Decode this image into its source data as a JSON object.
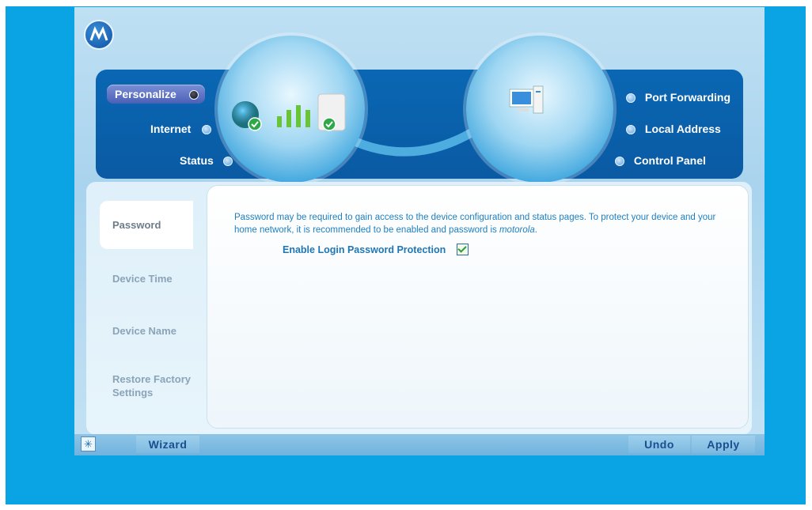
{
  "nav": {
    "left": [
      {
        "label": "Personalize",
        "active": true
      },
      {
        "label": "Internet",
        "active": false
      },
      {
        "label": "Status",
        "active": false
      }
    ],
    "right": [
      {
        "label": "Port Forwarding"
      },
      {
        "label": "Local Address"
      },
      {
        "label": "Control Panel"
      }
    ]
  },
  "sidebar": {
    "items": [
      {
        "label": "Password",
        "active": true
      },
      {
        "label": "Device Time"
      },
      {
        "label": "Device Name"
      },
      {
        "label": "Restore Factory Settings"
      }
    ]
  },
  "main": {
    "description_pre": "Password may be required to gain access to the device configuration and status pages. To protect your device and your home network, it is recommended to be enabled and password is ",
    "description_italic": "motorola",
    "description_post": ".",
    "enable_label": "Enable Login Password Protection",
    "enable_checked": true
  },
  "footer": {
    "wizard_label": "Wizard",
    "undo_label": "Undo",
    "apply_label": "Apply"
  },
  "icons": {
    "logo": "motorola-logo",
    "wizard": "wizard-icon"
  },
  "colors": {
    "accent": "#0a67b3",
    "background": "#0aa3e4",
    "text_link": "#1f7fbf"
  }
}
